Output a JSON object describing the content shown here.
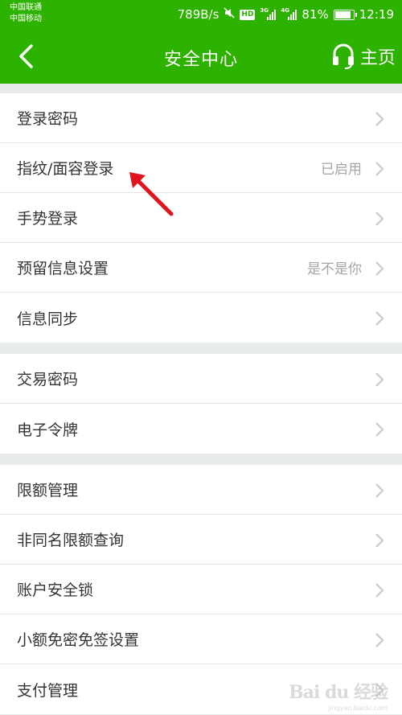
{
  "status_bar": {
    "carrier1": "中国联通",
    "carrier2": "中国移动",
    "speed": "789B/s",
    "net1": "3G",
    "net2": "4G",
    "battery": "81%",
    "battery_level": 0.81,
    "time": "12:19"
  },
  "nav": {
    "back_icon": "chevron-left-icon",
    "title": "安全中心",
    "home_icon": "headset-icon",
    "home_label": "主页"
  },
  "groups": [
    {
      "items": [
        {
          "label": "登录密码",
          "value": ""
        },
        {
          "label": "指纹/面容登录",
          "value": "已启用"
        },
        {
          "label": "手势登录",
          "value": ""
        },
        {
          "label": "预留信息设置",
          "value": "是不是你"
        },
        {
          "label": "信息同步",
          "value": ""
        }
      ]
    },
    {
      "items": [
        {
          "label": "交易密码",
          "value": ""
        },
        {
          "label": "电子令牌",
          "value": ""
        }
      ]
    },
    {
      "items": [
        {
          "label": "限额管理",
          "value": ""
        },
        {
          "label": "非同名限额查询",
          "value": ""
        },
        {
          "label": "账户安全锁",
          "value": ""
        },
        {
          "label": "小额免密免签设置",
          "value": ""
        },
        {
          "label": "支付管理",
          "value": ""
        }
      ]
    }
  ],
  "watermark": {
    "text": "Bai du 经验",
    "sub": "jingyan.baidu.com"
  },
  "colors": {
    "brand": "#2eb200",
    "annotation": "#e0141e",
    "chevron": "#c8c8c8"
  }
}
